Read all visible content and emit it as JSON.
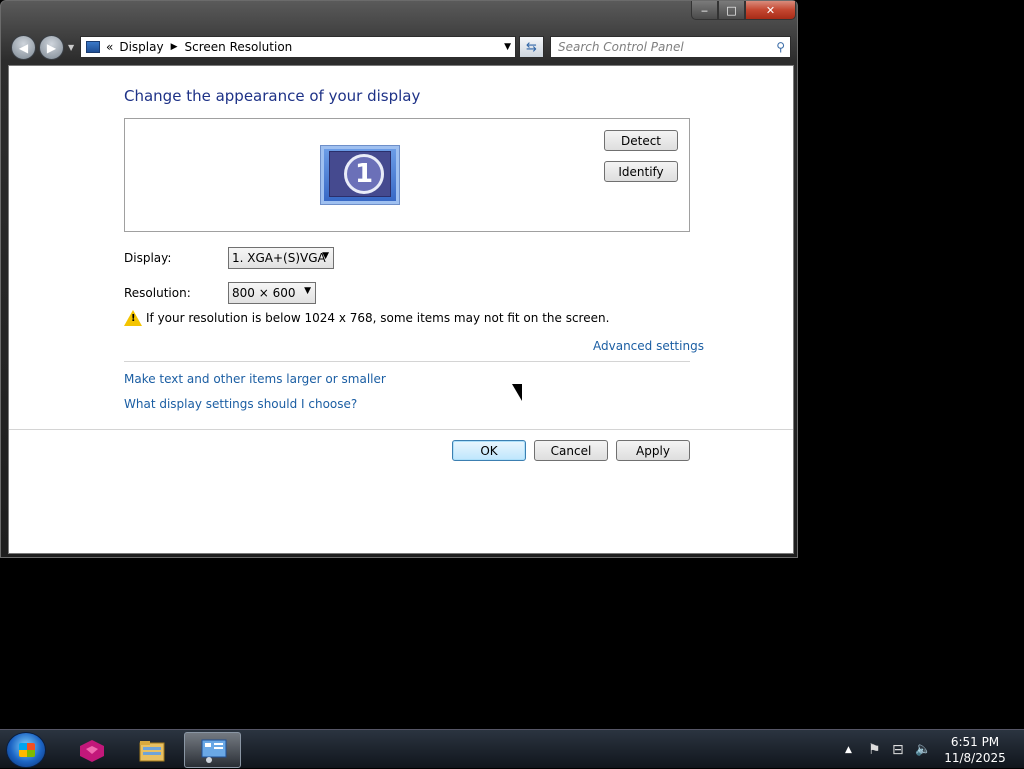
{
  "window": {
    "minimize": "‒",
    "maximize": "□",
    "close": "✕",
    "nav_back": "◀",
    "nav_forward": "▶",
    "nav_dropdown": "▼",
    "breadcrumb_prefix": "«",
    "breadcrumb": [
      "Display",
      "Screen Resolution"
    ],
    "breadcrumb_sep": "▶",
    "address_dropdown": "▼",
    "refresh_glyph": "⇆",
    "search_placeholder": "Search Control Panel",
    "search_glyph": "⚲"
  },
  "main": {
    "heading": "Change the appearance of your display",
    "monitor_number": "1",
    "detect_label": "Detect",
    "identify_label": "Identify",
    "display_label": "Display:",
    "display_value": "1. XGA+(S)VGA",
    "resolution_label": "Resolution:",
    "resolution_value": "800 × 600",
    "select_arrow": "▼",
    "warning_mark": "!",
    "warning_text": "If your resolution is below 1024 x 768, some items may not fit on the screen.",
    "advanced_settings": "Advanced settings",
    "link_text_size": "Make text and other items larger or smaller",
    "link_help": "What display settings should I choose?",
    "ok_label": "OK",
    "cancel_label": "Cancel",
    "apply_label": "Apply"
  },
  "taskbar": {
    "tray_show_hidden": "▲",
    "tray_action_center": "⚑",
    "tray_network": "⊟",
    "tray_volume": "🔈",
    "time": "6:51 PM",
    "date": "11/8/2025"
  },
  "colors": {
    "heading": "#1e3287",
    "link": "#1b5ea3",
    "warning": "#f4c400"
  }
}
